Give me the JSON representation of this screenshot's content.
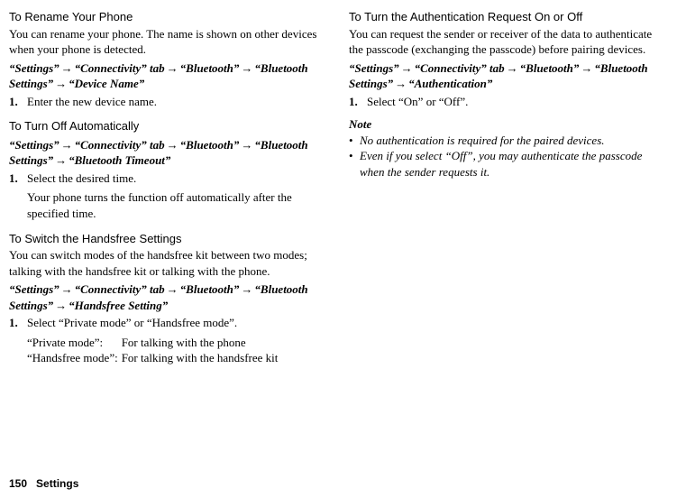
{
  "left": {
    "sec1": {
      "heading": "To Rename Your Phone",
      "body": "You can rename your phone. The name is shown on other devices when your phone is detected.",
      "path_parts": [
        "“Settings”",
        "“Connectivity” tab",
        "“Bluetooth”",
        "“Bluetooth Settings”",
        "“Device Name”"
      ],
      "step_num": "1.",
      "step_text": "Enter the new device name."
    },
    "sec2": {
      "heading": "To Turn Off Automatically",
      "path_parts": [
        "“Settings”",
        "“Connectivity” tab",
        "“Bluetooth”",
        "“Bluetooth Settings”",
        "“Bluetooth Timeout”"
      ],
      "step_num": "1.",
      "step_text": "Select the desired time.",
      "substep": "Your phone turns the function off automatically after the specified time."
    },
    "sec3": {
      "heading": "To Switch the Handsfree Settings",
      "body": "You can switch modes of the handsfree kit between two modes; talking with the handsfree kit or talking with the phone.",
      "path_parts": [
        "“Settings”",
        "“Connectivity” tab",
        "“Bluetooth”",
        "“Bluetooth Settings”",
        "“Handsfree Setting”"
      ],
      "step_num": "1.",
      "step_text": "Select “Private mode” or “Handsfree mode”.",
      "modes": {
        "r1_label": "“Private mode”:",
        "r1_desc": "For talking with the phone",
        "r2_label": "“Handsfree mode”:",
        "r2_desc": "For talking with the handsfree kit"
      }
    }
  },
  "right": {
    "sec1": {
      "heading": "To Turn the Authentication Request On or Off",
      "body": "You can request the sender or receiver of the data to authenticate the passcode (exchanging the passcode) before pairing devices.",
      "path_parts": [
        "“Settings”",
        "“Connectivity” tab",
        "“Bluetooth”",
        "“Bluetooth Settings”",
        "“Authentication”"
      ],
      "step_num": "1.",
      "step_text": "Select “On” or “Off”."
    },
    "note": {
      "label": "Note",
      "b1": "No authentication is required for the paired devices.",
      "b2": "Even if you select “Off”, you may authenticate the passcode when the sender requests it."
    }
  },
  "arrow": "→",
  "bullet": "•",
  "footer": {
    "page": "150",
    "section": "Settings"
  }
}
